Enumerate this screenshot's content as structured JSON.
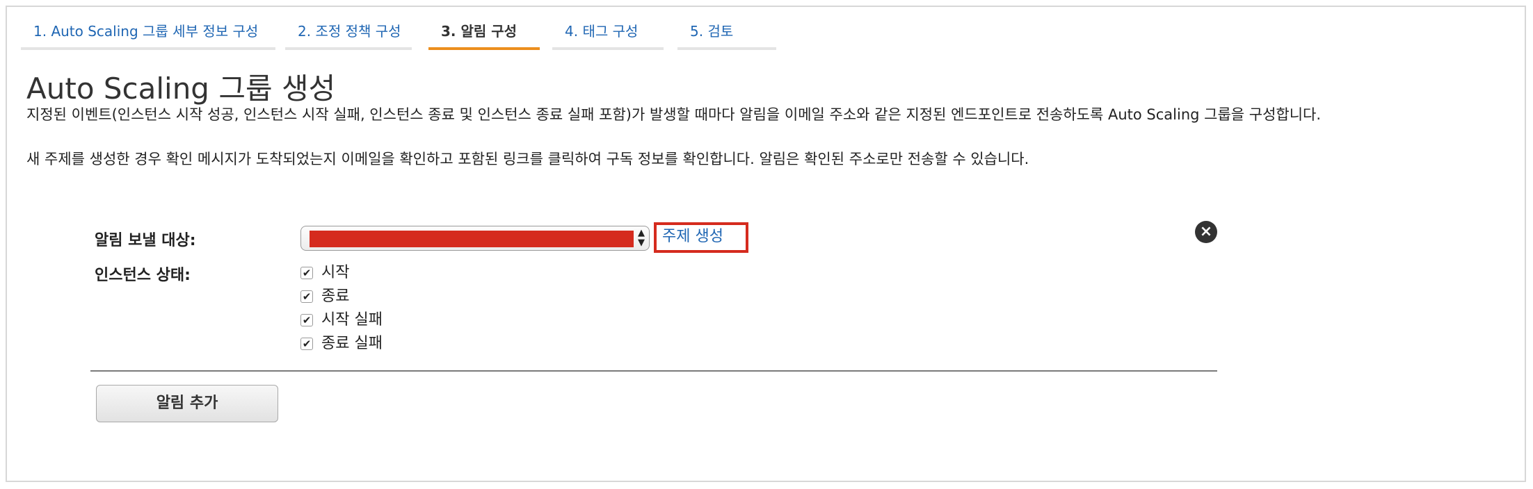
{
  "steps": [
    {
      "label": "1. Auto Scaling 그룹 세부 정보 구성"
    },
    {
      "label": "2. 조정 정책 구성"
    },
    {
      "label": "3. 알림 구성"
    },
    {
      "label": "4. 태그 구성"
    },
    {
      "label": "5. 검토"
    }
  ],
  "active_step": 3,
  "page": {
    "title": "Auto Scaling 그룹 생성",
    "description1": "지정된 이벤트(인스턴스 시작 성공, 인스턴스 시작 실패, 인스턴스 종료 및 인스턴스 종료 실패 포함)가 발생할 때마다 알림을 이메일 주소와 같은 지정된 엔드포인트로 전송하도록 Auto Scaling 그룹을 구성합니다.",
    "description2": "새 주제를 생성한 경우 확인 메시지가 도착되었는지 이메일을 확인하고 포함된 링크를 클릭하여 구독 정보를 확인합니다. 알림은 확인된 주소로만 전송할 수 있습니다."
  },
  "form": {
    "send_to_label": "알림 보낼 대상:",
    "create_topic_link": "주제 생성",
    "instance_state_label": "인스턴스 상태:",
    "states": [
      {
        "label": "시작",
        "checked": true
      },
      {
        "label": "종료",
        "checked": true
      },
      {
        "label": "시작 실패",
        "checked": true
      },
      {
        "label": "종료 실패",
        "checked": true
      }
    ],
    "add_notification_button": "알림 추가"
  },
  "icons": {
    "remove": "close-circle-icon",
    "select_arrows": "up-down-arrows-icon",
    "check": "checkmark-icon"
  },
  "colors": {
    "link": "#1f66b3",
    "active_step_underline": "#ec8e1e",
    "highlight_box": "#d52b1e",
    "redaction": "#d52b1e"
  }
}
